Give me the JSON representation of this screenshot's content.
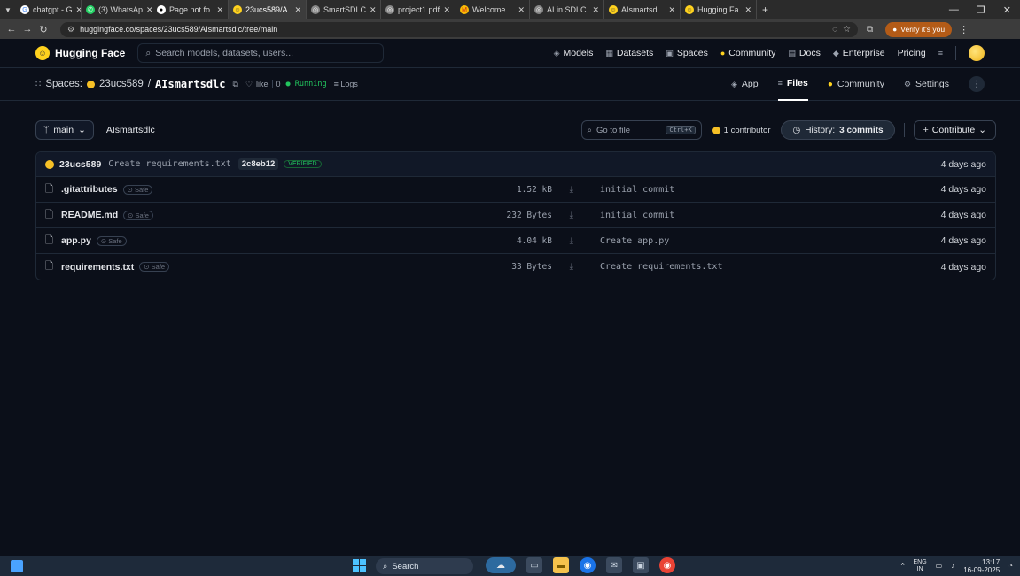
{
  "browser": {
    "tabs": [
      {
        "title": "chatgpt - G",
        "icon": "google-icon"
      },
      {
        "title": "(3) WhatsAp",
        "icon": "whatsapp-icon"
      },
      {
        "title": "Page not fo",
        "icon": "github-icon"
      },
      {
        "title": "23ucs589/A",
        "icon": "huggingface-icon",
        "active": true
      },
      {
        "title": "SmartSDLC",
        "icon": "globe-icon"
      },
      {
        "title": "project1.pdf",
        "icon": "globe-icon"
      },
      {
        "title": "Welcome",
        "icon": "gmail-icon"
      },
      {
        "title": "AI in SDLC",
        "icon": "globe-icon"
      },
      {
        "title": "AIsmartsdl",
        "icon": "huggingface-icon"
      },
      {
        "title": "Hugging Fa",
        "icon": "huggingface-icon"
      }
    ],
    "new_tab": "+",
    "url": "huggingface.co/spaces/23ucs589/AIsmartsdlc/tree/main",
    "verify_label": "Verify it's you"
  },
  "hf": {
    "brand": "Hugging Face",
    "search_placeholder": "Search models, datasets, users...",
    "nav": [
      "Models",
      "Datasets",
      "Spaces",
      "Community",
      "Docs",
      "Enterprise",
      "Pricing"
    ],
    "menu_icon": "≡"
  },
  "space": {
    "prefix": "Spaces:",
    "owner": "23ucs589",
    "slash": "/",
    "repo": "AIsmartsdlc",
    "like_label": "like",
    "like_count": "0",
    "status": "Running",
    "logs_label": "Logs",
    "tabs": [
      "App",
      "Files",
      "Community",
      "Settings"
    ],
    "active_tab": "Files"
  },
  "files": {
    "branch": "main",
    "root": "AIsmartsdlc",
    "goto_placeholder": "Go to file",
    "goto_shortcut": "Ctrl+K",
    "contributors": "1 contributor",
    "history_prefix": "History:",
    "history_count": "3 commits",
    "contribute_label": "Contribute",
    "last_commit": {
      "author": "23ucs589",
      "message": "Create requirements.txt",
      "hash": "2c8eb12",
      "verified": "VERIFIED",
      "time": "4 days ago"
    },
    "safe_label": "Safe",
    "rows": [
      {
        "name": ".gitattributes",
        "size": "1.52 kB",
        "commit": "initial commit",
        "time": "4 days ago"
      },
      {
        "name": "README.md",
        "size": "232 Bytes",
        "commit": "initial commit",
        "time": "4 days ago"
      },
      {
        "name": "app.py",
        "size": "4.04 kB",
        "commit": "Create app.py",
        "time": "4 days ago"
      },
      {
        "name": "requirements.txt",
        "size": "33 Bytes",
        "commit": "Create requirements.txt",
        "time": "4 days ago"
      }
    ]
  },
  "taskbar": {
    "search_label": "Search",
    "lang_top": "ENG",
    "lang_bottom": "IN",
    "time": "13:17",
    "date": "16-09-2025"
  },
  "colors": {
    "accent_yellow": "#ffd21e",
    "running_green": "#22c55e",
    "page_bg": "#0b0f19"
  }
}
